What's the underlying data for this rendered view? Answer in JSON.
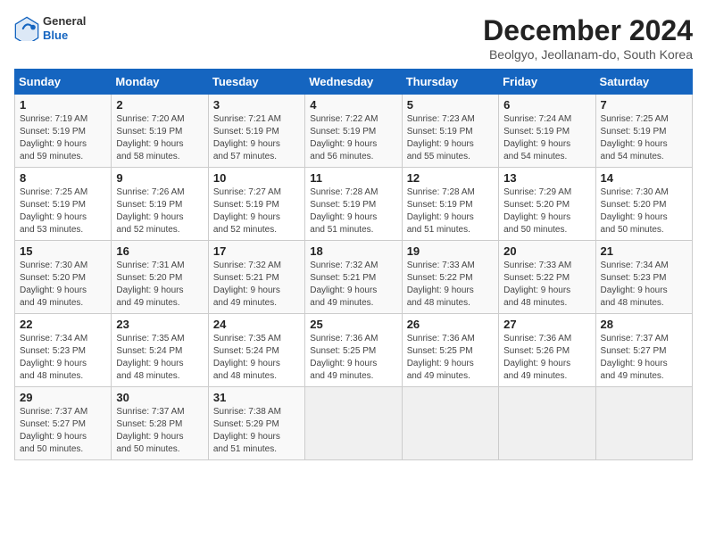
{
  "header": {
    "logo_general": "General",
    "logo_blue": "Blue",
    "calendar_title": "December 2024",
    "calendar_subtitle": "Beolgyo, Jeollanam-do, South Korea"
  },
  "days_of_week": [
    "Sunday",
    "Monday",
    "Tuesday",
    "Wednesday",
    "Thursday",
    "Friday",
    "Saturday"
  ],
  "weeks": [
    [
      {
        "day": "1",
        "info": "Sunrise: 7:19 AM\nSunset: 5:19 PM\nDaylight: 9 hours\nand 59 minutes."
      },
      {
        "day": "2",
        "info": "Sunrise: 7:20 AM\nSunset: 5:19 PM\nDaylight: 9 hours\nand 58 minutes."
      },
      {
        "day": "3",
        "info": "Sunrise: 7:21 AM\nSunset: 5:19 PM\nDaylight: 9 hours\nand 57 minutes."
      },
      {
        "day": "4",
        "info": "Sunrise: 7:22 AM\nSunset: 5:19 PM\nDaylight: 9 hours\nand 56 minutes."
      },
      {
        "day": "5",
        "info": "Sunrise: 7:23 AM\nSunset: 5:19 PM\nDaylight: 9 hours\nand 55 minutes."
      },
      {
        "day": "6",
        "info": "Sunrise: 7:24 AM\nSunset: 5:19 PM\nDaylight: 9 hours\nand 54 minutes."
      },
      {
        "day": "7",
        "info": "Sunrise: 7:25 AM\nSunset: 5:19 PM\nDaylight: 9 hours\nand 54 minutes."
      }
    ],
    [
      {
        "day": "8",
        "info": "Sunrise: 7:25 AM\nSunset: 5:19 PM\nDaylight: 9 hours\nand 53 minutes."
      },
      {
        "day": "9",
        "info": "Sunrise: 7:26 AM\nSunset: 5:19 PM\nDaylight: 9 hours\nand 52 minutes."
      },
      {
        "day": "10",
        "info": "Sunrise: 7:27 AM\nSunset: 5:19 PM\nDaylight: 9 hours\nand 52 minutes."
      },
      {
        "day": "11",
        "info": "Sunrise: 7:28 AM\nSunset: 5:19 PM\nDaylight: 9 hours\nand 51 minutes."
      },
      {
        "day": "12",
        "info": "Sunrise: 7:28 AM\nSunset: 5:19 PM\nDaylight: 9 hours\nand 51 minutes."
      },
      {
        "day": "13",
        "info": "Sunrise: 7:29 AM\nSunset: 5:20 PM\nDaylight: 9 hours\nand 50 minutes."
      },
      {
        "day": "14",
        "info": "Sunrise: 7:30 AM\nSunset: 5:20 PM\nDaylight: 9 hours\nand 50 minutes."
      }
    ],
    [
      {
        "day": "15",
        "info": "Sunrise: 7:30 AM\nSunset: 5:20 PM\nDaylight: 9 hours\nand 49 minutes."
      },
      {
        "day": "16",
        "info": "Sunrise: 7:31 AM\nSunset: 5:20 PM\nDaylight: 9 hours\nand 49 minutes."
      },
      {
        "day": "17",
        "info": "Sunrise: 7:32 AM\nSunset: 5:21 PM\nDaylight: 9 hours\nand 49 minutes."
      },
      {
        "day": "18",
        "info": "Sunrise: 7:32 AM\nSunset: 5:21 PM\nDaylight: 9 hours\nand 49 minutes."
      },
      {
        "day": "19",
        "info": "Sunrise: 7:33 AM\nSunset: 5:22 PM\nDaylight: 9 hours\nand 48 minutes."
      },
      {
        "day": "20",
        "info": "Sunrise: 7:33 AM\nSunset: 5:22 PM\nDaylight: 9 hours\nand 48 minutes."
      },
      {
        "day": "21",
        "info": "Sunrise: 7:34 AM\nSunset: 5:23 PM\nDaylight: 9 hours\nand 48 minutes."
      }
    ],
    [
      {
        "day": "22",
        "info": "Sunrise: 7:34 AM\nSunset: 5:23 PM\nDaylight: 9 hours\nand 48 minutes."
      },
      {
        "day": "23",
        "info": "Sunrise: 7:35 AM\nSunset: 5:24 PM\nDaylight: 9 hours\nand 48 minutes."
      },
      {
        "day": "24",
        "info": "Sunrise: 7:35 AM\nSunset: 5:24 PM\nDaylight: 9 hours\nand 48 minutes."
      },
      {
        "day": "25",
        "info": "Sunrise: 7:36 AM\nSunset: 5:25 PM\nDaylight: 9 hours\nand 49 minutes."
      },
      {
        "day": "26",
        "info": "Sunrise: 7:36 AM\nSunset: 5:25 PM\nDaylight: 9 hours\nand 49 minutes."
      },
      {
        "day": "27",
        "info": "Sunrise: 7:36 AM\nSunset: 5:26 PM\nDaylight: 9 hours\nand 49 minutes."
      },
      {
        "day": "28",
        "info": "Sunrise: 7:37 AM\nSunset: 5:27 PM\nDaylight: 9 hours\nand 49 minutes."
      }
    ],
    [
      {
        "day": "29",
        "info": "Sunrise: 7:37 AM\nSunset: 5:27 PM\nDaylight: 9 hours\nand 50 minutes."
      },
      {
        "day": "30",
        "info": "Sunrise: 7:37 AM\nSunset: 5:28 PM\nDaylight: 9 hours\nand 50 minutes."
      },
      {
        "day": "31",
        "info": "Sunrise: 7:38 AM\nSunset: 5:29 PM\nDaylight: 9 hours\nand 51 minutes."
      },
      {
        "day": "",
        "info": ""
      },
      {
        "day": "",
        "info": ""
      },
      {
        "day": "",
        "info": ""
      },
      {
        "day": "",
        "info": ""
      }
    ]
  ]
}
